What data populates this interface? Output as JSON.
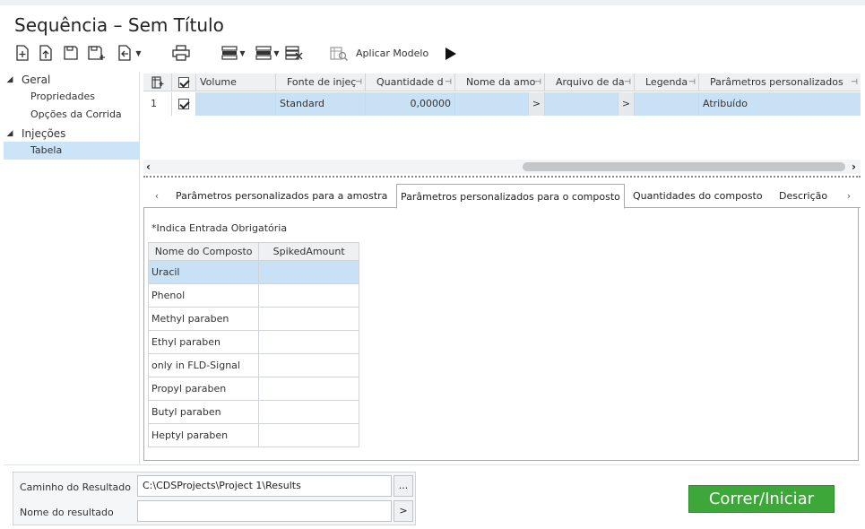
{
  "window": {
    "title": "Sequência – Sem Título"
  },
  "toolbar": {
    "apply_model_label": "Aplicar Modelo",
    "icons": [
      "new-icon",
      "upload-icon",
      "save-icon",
      "save-as-icon",
      "export-icon",
      "print-icon",
      "insert-row-icon",
      "delete-row-icon",
      "clear-table-icon",
      "apply-model-icon",
      "play-icon"
    ]
  },
  "nav": {
    "groups": [
      {
        "label": "Geral",
        "items": [
          "Propriedades",
          "Opções da Corrida"
        ]
      },
      {
        "label": "Injeções",
        "items": [
          "Tabela"
        ]
      }
    ],
    "selected": "Tabela"
  },
  "grid": {
    "columns": [
      "Volume",
      "Fonte de injeç",
      "Quantidade d",
      "Nome da amo",
      "Arquivo de da",
      "Legenda",
      "Parâmetros personalizados"
    ],
    "rows": [
      {
        "index": "1",
        "checked": true,
        "volume": "",
        "source": "Standard",
        "quantity": "0,00000",
        "sample_name": "",
        "sample_btn": ">",
        "data_file": "",
        "data_btn": ">",
        "legend": "",
        "custom_params": "Atribuído"
      }
    ]
  },
  "tabs": {
    "items": [
      "Parâmetros personalizados para a amostra",
      "Parâmetros personalizados para o composto",
      "Quantidades do composto",
      "Descrição"
    ],
    "active_index": 1,
    "prev_arrow": "‹",
    "next_arrow": "›"
  },
  "compound_panel": {
    "required_note": "Indica Entrada Obrigatória",
    "required_marker": "*",
    "headers": [
      "Nome do Composto",
      "SpikedAmount"
    ],
    "rows": [
      {
        "name": "Uracil",
        "value": ""
      },
      {
        "name": "Phenol",
        "value": ""
      },
      {
        "name": "Methyl paraben",
        "value": ""
      },
      {
        "name": "Ethyl paraben",
        "value": ""
      },
      {
        "name": "only in FLD-Signal",
        "value": ""
      },
      {
        "name": "Propyl paraben",
        "value": ""
      },
      {
        "name": "Butyl paraben",
        "value": ""
      },
      {
        "name": "Heptyl paraben",
        "value": ""
      }
    ],
    "selected_row": 0
  },
  "result": {
    "path_label": "Caminho do Resultado",
    "path_value": "C:\\CDSProjects\\Project 1\\Results",
    "path_btn": "...",
    "name_label": "Nome do resultado",
    "name_value": "",
    "name_btn": ">"
  },
  "run_button": {
    "label": "Correr/Iniciar",
    "color": "#3ea73a"
  }
}
